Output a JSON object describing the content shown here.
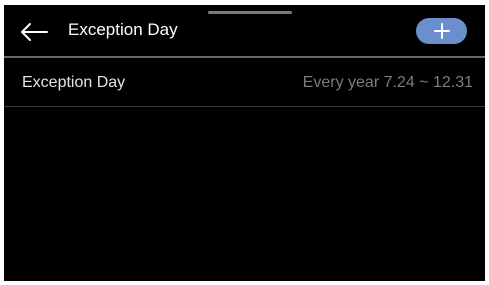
{
  "header": {
    "title": "Exception Day",
    "back_icon": "arrow-left-icon",
    "add_icon": "plus-icon",
    "add_button_color": "#6b8fcc"
  },
  "list": {
    "items": [
      {
        "label": "Exception Day",
        "value": "Every year 7.24 ~ 12.31"
      }
    ]
  },
  "colors": {
    "background": "#000000",
    "title_text": "#ffffff",
    "value_text": "#7c7c7c",
    "divider": "#6a6a6a"
  }
}
